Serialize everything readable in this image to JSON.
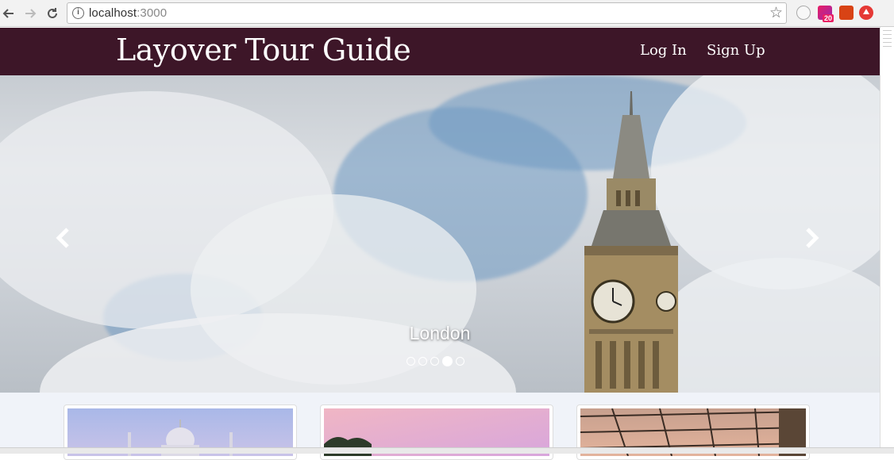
{
  "browser": {
    "url_host": "localhost",
    "url_port": ":3000",
    "back_icon": "arrow-left-icon",
    "forward_icon": "arrow-right-icon",
    "reload_icon": "reload-icon",
    "bookmark_icon": "star-icon",
    "extensions": [
      "extension-icon",
      "extension-badge-icon",
      "extension-app-icon",
      "upload-icon"
    ],
    "extension_badge": "20"
  },
  "header": {
    "brand": "Layover Tour Guide",
    "nav": {
      "login": "Log In",
      "signup": "Sign Up"
    }
  },
  "carousel": {
    "caption": "London",
    "slide_count": 5,
    "active_index": 3,
    "prev_icon": "chevron-left-icon",
    "next_icon": "chevron-right-icon"
  },
  "colors": {
    "header_bg": "#3d1628",
    "cards_bg": "#f0f3f9"
  }
}
